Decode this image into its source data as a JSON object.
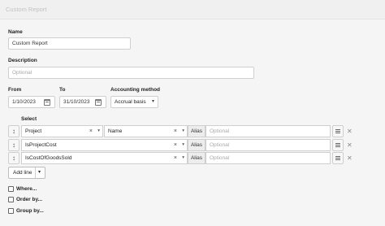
{
  "window": {
    "title": "Custom Report"
  },
  "form": {
    "name": {
      "label": "Name",
      "value": "Custom Report"
    },
    "description": {
      "label": "Description",
      "placeholder": "Optional"
    },
    "from": {
      "label": "From",
      "value": "1/10/2023"
    },
    "to": {
      "label": "To",
      "value": "31/10/2023"
    },
    "accounting_method": {
      "label": "Accounting method",
      "value": "Accrual basis"
    }
  },
  "select": {
    "label": "Select",
    "rows": [
      {
        "field": "Project",
        "sub_field": "Name",
        "alias_label": "Alias",
        "alias_placeholder": "Optional"
      },
      {
        "field": "IsProjectCost",
        "sub_field": "",
        "alias_label": "Alias",
        "alias_placeholder": "Optional"
      },
      {
        "field": "IsCostOfGoodsSold",
        "sub_field": "",
        "alias_label": "Alias",
        "alias_placeholder": "Optional"
      }
    ],
    "add_line_label": "Add line"
  },
  "options": {
    "where": "Where...",
    "order_by": "Order by...",
    "group_by": "Group by..."
  },
  "icons": {
    "clear": "×",
    "dropdown": "▾",
    "drag": "↕",
    "remove": "✕"
  }
}
